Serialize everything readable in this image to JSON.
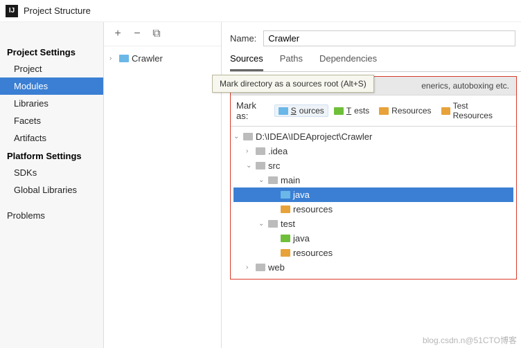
{
  "title": "Project Structure",
  "sidebar": {
    "sections": [
      {
        "heading": "Project Settings",
        "items": [
          "Project",
          "Modules",
          "Libraries",
          "Facets",
          "Artifacts"
        ]
      },
      {
        "heading": "Platform Settings",
        "items": [
          "SDKs",
          "Global Libraries"
        ]
      }
    ],
    "selected": "Modules",
    "problems": "Problems"
  },
  "toolbar": {
    "add": "+",
    "remove": "−",
    "copy": "⧉"
  },
  "modules": {
    "items": [
      "Crawler"
    ]
  },
  "name_label": "Name:",
  "name_value": "Crawler",
  "tabs": [
    "Sources",
    "Paths",
    "Dependencies"
  ],
  "active_tab": "Sources",
  "lang_panel_tail": "enerics, autoboxing etc.",
  "mark_as_label": "Mark as:",
  "mark_buttons": {
    "sources": "Sources",
    "tests": "Tests",
    "resources": "Resources",
    "test_resources": "Test Resources"
  },
  "tooltip": "Mark directory as a sources root (Alt+S)",
  "tree": {
    "root": "D:\\IDEA\\IDEAproject\\Crawler",
    "idea": ".idea",
    "src": "src",
    "main": "main",
    "java_main": "java",
    "resources_main": "resources",
    "test": "test",
    "java_test": "java",
    "resources_test": "resources",
    "web": "web"
  },
  "watermark": "blog.csdn.n@51CTO博客"
}
